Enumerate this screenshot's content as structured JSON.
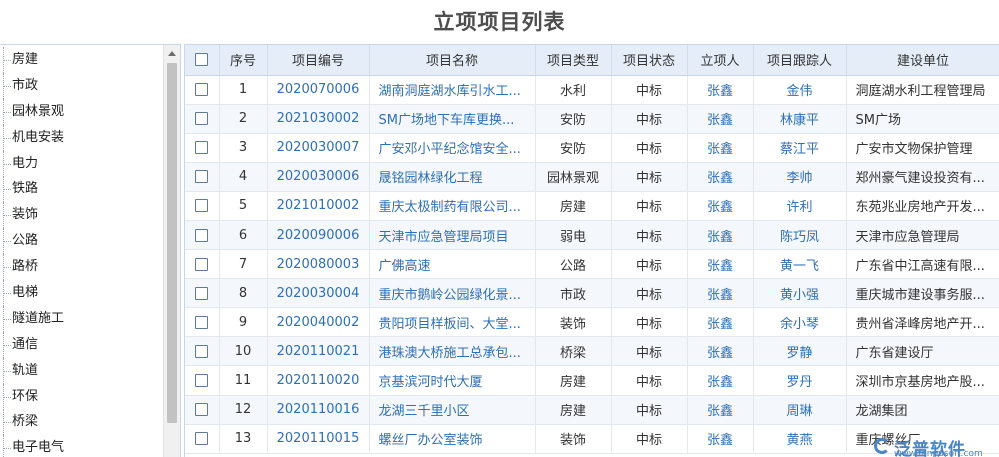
{
  "page": {
    "title": "立项项目列表"
  },
  "tree": {
    "items": [
      "房建",
      "市政",
      "园林景观",
      "机电安装",
      "电力",
      "铁路",
      "装饰",
      "公路",
      "路桥",
      "电梯",
      "隧道施工",
      "通信",
      "轨道",
      "环保",
      "桥梁",
      "电子电气"
    ]
  },
  "grid": {
    "columns": [
      "序号",
      "项目编号",
      "项目名称",
      "项目类型",
      "项目状态",
      "立项人",
      "项目跟踪人",
      "建设单位"
    ],
    "rows": [
      {
        "no": "1",
        "code": "2020070006",
        "name": "湖南洞庭湖水库引水工...",
        "type": "水利",
        "status": "中标",
        "creator": "张鑫",
        "tracker": "金伟",
        "unit": "洞庭湖水利工程管理局"
      },
      {
        "no": "2",
        "code": "2021030002",
        "name": "SM广场地下车库更换...",
        "type": "安防",
        "status": "中标",
        "creator": "张鑫",
        "tracker": "林康平",
        "unit": "SM广场"
      },
      {
        "no": "3",
        "code": "2020030007",
        "name": "广安邓小平纪念馆安全...",
        "type": "安防",
        "status": "中标",
        "creator": "张鑫",
        "tracker": "蔡江平",
        "unit": "广安市文物保护管理"
      },
      {
        "no": "4",
        "code": "2020030006",
        "name": "晟铭园林绿化工程",
        "type": "园林景观",
        "status": "中标",
        "creator": "张鑫",
        "tracker": "李帅",
        "unit": "郑州豪气建设投资有..."
      },
      {
        "no": "5",
        "code": "2021010002",
        "name": "重庆太极制药有限公司...",
        "type": "房建",
        "status": "中标",
        "creator": "张鑫",
        "tracker": "许利",
        "unit": "东苑兆业房地产开发..."
      },
      {
        "no": "6",
        "code": "2020090006",
        "name": "天津市应急管理局项目",
        "type": "弱电",
        "status": "中标",
        "creator": "张鑫",
        "tracker": "陈巧凤",
        "unit": "天津市应急管理局"
      },
      {
        "no": "7",
        "code": "2020080003",
        "name": "广佛高速",
        "type": "公路",
        "status": "中标",
        "creator": "张鑫",
        "tracker": "黄一飞",
        "unit": "广东省中江高速有限..."
      },
      {
        "no": "8",
        "code": "2020030004",
        "name": "重庆市鹅岭公园绿化景...",
        "type": "市政",
        "status": "中标",
        "creator": "张鑫",
        "tracker": "黄小强",
        "unit": "重庆城市建设事务服..."
      },
      {
        "no": "9",
        "code": "2020040002",
        "name": "贵阳项目样板间、大堂...",
        "type": "装饰",
        "status": "中标",
        "creator": "张鑫",
        "tracker": "余小琴",
        "unit": "贵州省泽峰房地产开..."
      },
      {
        "no": "10",
        "code": "2020110021",
        "name": "港珠澳大桥施工总承包...",
        "type": "桥梁",
        "status": "中标",
        "creator": "张鑫",
        "tracker": "罗静",
        "unit": "广东省建设厅"
      },
      {
        "no": "11",
        "code": "2020110020",
        "name": "京基滨河时代大厦",
        "type": "房建",
        "status": "中标",
        "creator": "张鑫",
        "tracker": "罗丹",
        "unit": "深圳市京基房地产股..."
      },
      {
        "no": "12",
        "code": "2020110016",
        "name": "龙湖三千里小区",
        "type": "房建",
        "status": "中标",
        "creator": "张鑫",
        "tracker": "周琳",
        "unit": "龙湖集团"
      },
      {
        "no": "13",
        "code": "2020110015",
        "name": "螺丝厂办公室装饰",
        "type": "装饰",
        "status": "中标",
        "creator": "张鑫",
        "tracker": "黄燕",
        "unit": "重庆螺丝厂"
      }
    ]
  },
  "watermark": {
    "name": "泛普软件",
    "url": "www.fanpusoft.com"
  },
  "colors": {
    "link": "#2f6fb5",
    "header_bg": "#e5eef8",
    "stripe": "#f4f8fc",
    "border": "#c8d6e6"
  }
}
